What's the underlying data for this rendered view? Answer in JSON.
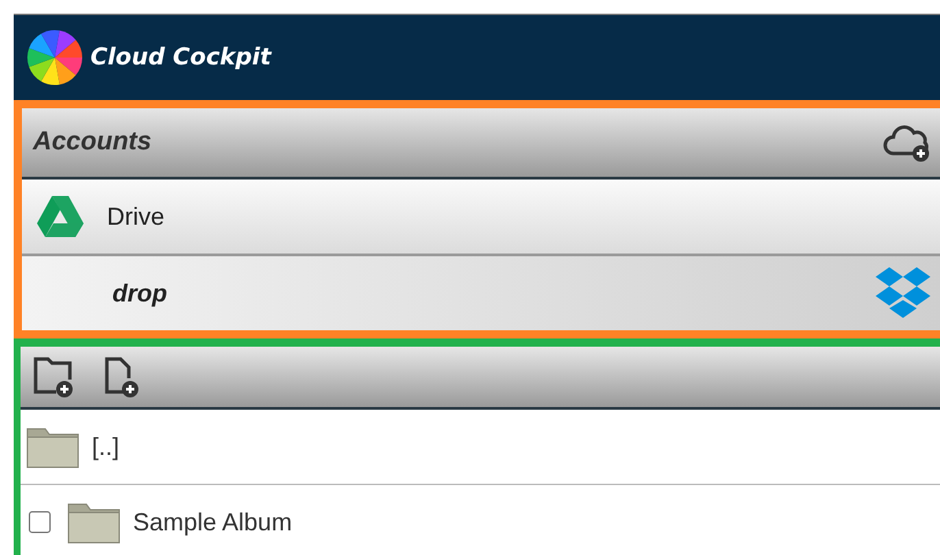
{
  "app": {
    "title": "Cloud Cockpit"
  },
  "accounts": {
    "title": "Accounts",
    "items": [
      {
        "name": "Drive",
        "kind": "drive",
        "selected": false
      },
      {
        "name": "drop",
        "kind": "dropbox",
        "selected": true
      }
    ]
  },
  "files": [
    {
      "name": "[..]",
      "kind": "parent"
    },
    {
      "name": "Sample Album",
      "kind": "folder",
      "checked": false
    }
  ]
}
